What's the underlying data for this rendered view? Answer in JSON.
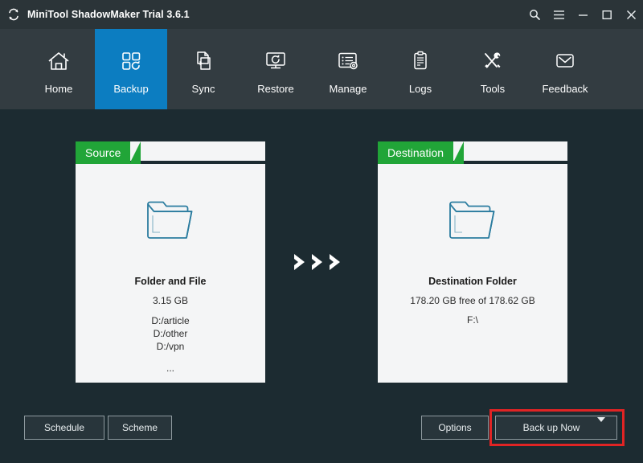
{
  "window": {
    "title": "MiniTool ShadowMaker Trial 3.6.1",
    "logo_icon": "sync-arrows-icon",
    "controls": [
      {
        "name": "search-icon",
        "label": "Search"
      },
      {
        "name": "menu-icon",
        "label": "Menu"
      },
      {
        "name": "minimize-icon",
        "label": "Minimize"
      },
      {
        "name": "maximize-icon",
        "label": "Maximize"
      },
      {
        "name": "close-icon",
        "label": "Close"
      }
    ]
  },
  "nav": {
    "active": "Backup",
    "items": [
      {
        "label": "Home",
        "icon": "home-icon"
      },
      {
        "label": "Backup",
        "icon": "backup-squares-icon"
      },
      {
        "label": "Sync",
        "icon": "sync-file-icon"
      },
      {
        "label": "Restore",
        "icon": "restore-monitor-icon"
      },
      {
        "label": "Manage",
        "icon": "manage-list-gear-icon"
      },
      {
        "label": "Logs",
        "icon": "logs-clipboard-icon"
      },
      {
        "label": "Tools",
        "icon": "tools-wrench-screwdriver-icon"
      },
      {
        "label": "Feedback",
        "icon": "feedback-envelope-icon"
      }
    ]
  },
  "main": {
    "transfer_arrows": "chevrons-right-icon",
    "source": {
      "tab_label": "Source",
      "folder_icon": "folder-icon",
      "title": "Folder and File",
      "size": "3.15 GB",
      "paths": [
        "D:/article",
        "D:/other",
        "D:/vpn"
      ],
      "ellipsis": "..."
    },
    "destination": {
      "tab_label": "Destination",
      "folder_icon": "folder-icon",
      "title": "Destination Folder",
      "free_space": "178.20 GB free of 178.62 GB",
      "drive": "F:\\"
    }
  },
  "actions": {
    "schedule": "Schedule",
    "scheme": "Scheme",
    "options": "Options",
    "backup_now": "Back up Now",
    "backup_dropdown_icon": "chevron-down-icon"
  },
  "colors": {
    "titlebar_bg": "#2b3438",
    "navbar_bg": "#333c41",
    "active_tab": "#0c7dc1",
    "content_bg": "#1c2b31",
    "panel_bg": "#f4f5f6",
    "tab_green": "#21a538",
    "folder_outline": "#2c7da0",
    "highlight_red": "#e02424"
  }
}
